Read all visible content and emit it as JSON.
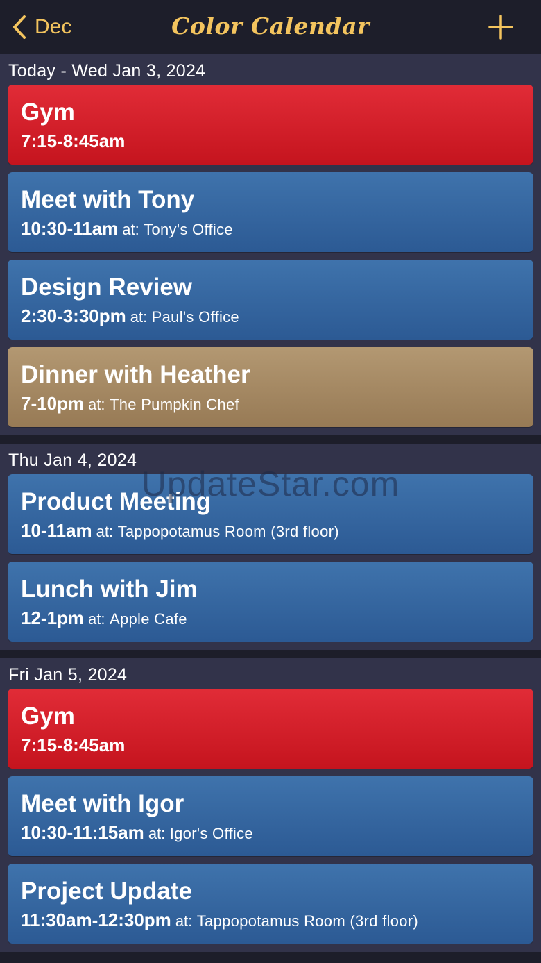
{
  "nav": {
    "back_label": "Dec",
    "title": "Color Calendar",
    "accent_color": "#f3c45e"
  },
  "days": [
    {
      "header": "Today - Wed Jan 3, 2024",
      "events": [
        {
          "title": "Gym",
          "time": "7:15-8:45am",
          "at": "",
          "location": "",
          "color": "red"
        },
        {
          "title": "Meet with Tony",
          "time": "10:30-11am",
          "at": "at:",
          "location": "Tony's Office",
          "color": "blue"
        },
        {
          "title": "Design Review",
          "time": "2:30-3:30pm",
          "at": "at:",
          "location": "Paul's Office",
          "color": "blue"
        },
        {
          "title": "Dinner with Heather",
          "time": "7-10pm",
          "at": "at:",
          "location": "The Pumpkin Chef",
          "color": "tan"
        }
      ]
    },
    {
      "header": "Thu Jan 4, 2024",
      "events": [
        {
          "title": "Product Meeting",
          "time": "10-11am",
          "at": "at:",
          "location": "Tappopotamus Room (3rd floor)",
          "color": "blue"
        },
        {
          "title": "Lunch with Jim",
          "time": "12-1pm",
          "at": "at:",
          "location": "Apple Cafe",
          "color": "blue"
        }
      ]
    },
    {
      "header": "Fri Jan 5, 2024",
      "events": [
        {
          "title": "Gym",
          "time": "7:15-8:45am",
          "at": "",
          "location": "",
          "color": "red"
        },
        {
          "title": "Meet with Igor",
          "time": "10:30-11:15am",
          "at": "at:",
          "location": "Igor's Office",
          "color": "blue"
        },
        {
          "title": "Project Update",
          "time": "11:30am-12:30pm",
          "at": "at:",
          "location": "Tappopotamus Room (3rd floor)",
          "color": "blue"
        }
      ]
    }
  ],
  "watermark": "UpdateStar.com",
  "colors": {
    "red": "#d11f2a",
    "blue": "#3566a0",
    "tan": "#a58a63",
    "background": "#1d1e2a",
    "section": "#32334a"
  }
}
